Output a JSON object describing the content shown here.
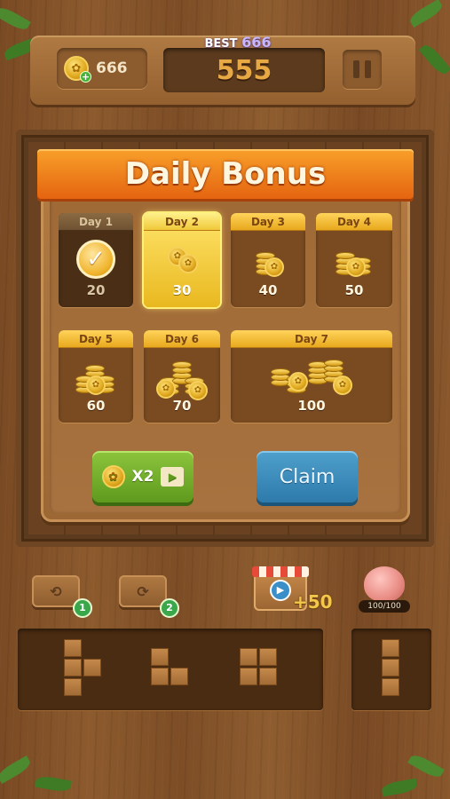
{
  "header": {
    "coin_balance": "666",
    "best_label": "BEST",
    "best_score": "666",
    "score": "555"
  },
  "dialog": {
    "title": "Daily Bonus",
    "days": [
      {
        "label": "Day 1",
        "amount": "20",
        "state": "claimed"
      },
      {
        "label": "Day 2",
        "amount": "30",
        "state": "current"
      },
      {
        "label": "Day 3",
        "amount": "40",
        "state": "locked"
      },
      {
        "label": "Day 4",
        "amount": "50",
        "state": "locked"
      },
      {
        "label": "Day 5",
        "amount": "60",
        "state": "locked"
      },
      {
        "label": "Day 6",
        "amount": "70",
        "state": "locked"
      },
      {
        "label": "Day 7",
        "amount": "100",
        "state": "locked"
      }
    ],
    "double_label": "X2",
    "claim_label": "Claim"
  },
  "tools": {
    "tool1_count": "1",
    "tool2_count": "2",
    "shop_reward": "+50",
    "piggy_progress": "100/100"
  },
  "icons": {
    "coin": "paw-coin-icon",
    "pause": "pause-icon",
    "check": "checkmark-icon",
    "video": "video-icon",
    "piggy": "piggy-bank-icon"
  },
  "colors": {
    "banner": "#f39a25",
    "claim_button": "#3b8cbd",
    "double_button": "#76b030",
    "highlight": "#ffe46a"
  }
}
